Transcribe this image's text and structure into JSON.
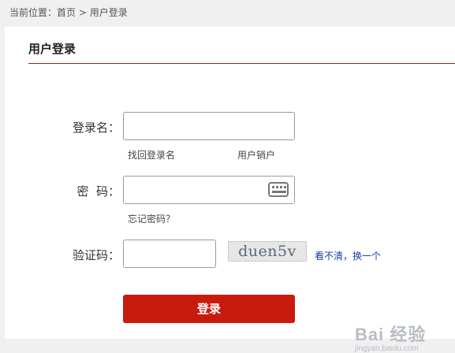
{
  "breadcrumb": {
    "prefix": "当前位置：",
    "home": "首页",
    "separator": " > ",
    "current": "用户登录"
  },
  "panel": {
    "title": "用户登录"
  },
  "form": {
    "username_label": "登录名：",
    "username_value": "",
    "find_username_link": "找回登录名",
    "cancel_account_link": "用户销户",
    "password_label": "密  码：",
    "password_value": "",
    "forgot_password_link": "忘记密码？",
    "captcha_label": "验证码：",
    "captcha_value": "",
    "captcha_image_text": "duen5v",
    "refresh_captcha_link": "看不清，换一个",
    "submit_label": "登录"
  },
  "watermark": {
    "main": "Bai 经验",
    "sub": "jingyan.baidu.com"
  },
  "colors": {
    "accent": "#c81a0d",
    "rule": "#9b1c1c",
    "link_blue": "#1a3ea6"
  },
  "icons": {
    "keyboard": "keyboard-icon"
  }
}
